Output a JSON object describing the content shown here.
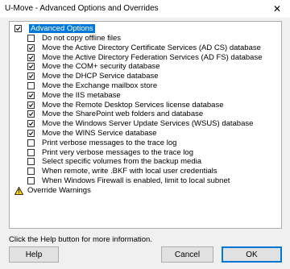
{
  "window": {
    "title": "U-Move - Advanced Options and Overrides",
    "close_glyph": "✕"
  },
  "tree": {
    "root_label": "Advanced Options",
    "items": [
      {
        "label": "Do not copy offline files",
        "checked": false
      },
      {
        "label": "Move the Active Directory Certificate Services (AD CS) database",
        "checked": true
      },
      {
        "label": "Move the Active Directory Federation Services (AD FS) database",
        "checked": true
      },
      {
        "label": "Move the COM+ security database",
        "checked": true
      },
      {
        "label": "Move the DHCP Service database",
        "checked": true
      },
      {
        "label": "Move the Exchange mailbox store",
        "checked": false
      },
      {
        "label": "Move the IIS metabase",
        "checked": true
      },
      {
        "label": "Move the Remote Desktop Services license database",
        "checked": true
      },
      {
        "label": "Move the SharePoint web folders and database",
        "checked": true
      },
      {
        "label": "Move the Windows Server Update Services (WSUS) database",
        "checked": true
      },
      {
        "label": "Move the WINS Service database",
        "checked": true
      },
      {
        "label": "Print verbose messages to the trace log",
        "checked": false
      },
      {
        "label": "Print very verbose messages to the trace log",
        "checked": false
      },
      {
        "label": "Select specific volumes from the backup media",
        "checked": false
      },
      {
        "label": "When remote, write .BKF with local user credentials",
        "checked": false
      },
      {
        "label": "When Windows Firewall is enabled, limit to local subnet",
        "checked": false
      }
    ],
    "override_label": "Override Warnings",
    "override_icon": "warning-icon"
  },
  "footer": {
    "help_text": "Click the Help button for more information.",
    "help_button": "Help",
    "cancel_button": "Cancel",
    "ok_button": "OK"
  },
  "colors": {
    "selection": "#0078d7",
    "default_button_border": "#0078d7"
  }
}
